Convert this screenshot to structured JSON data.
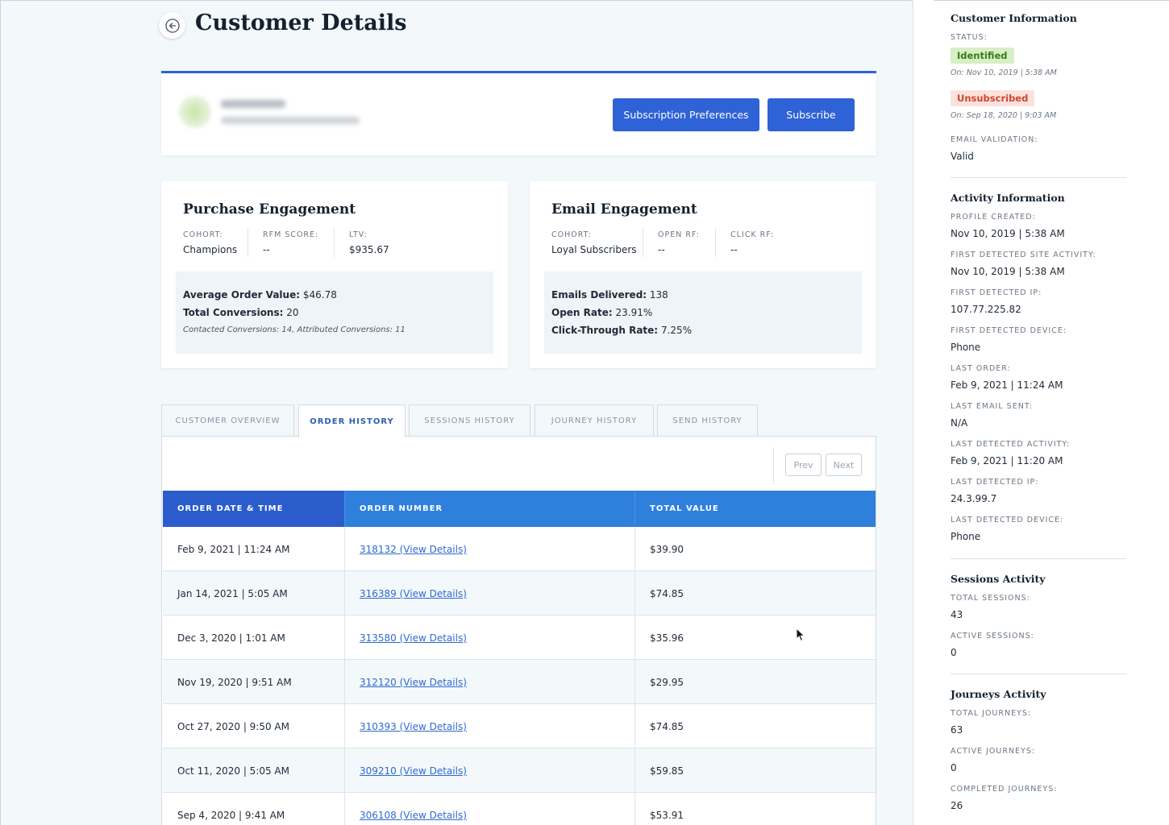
{
  "header": {
    "title": "Customer Details"
  },
  "customer_card": {
    "subscription_preferences_label": "Subscription Preferences",
    "subscribe_label": "Subscribe"
  },
  "purchase": {
    "title": "Purchase Engagement",
    "cohort_label": "COHORT:",
    "cohort": "Champions",
    "rfm_label": "RFM SCORE:",
    "rfm": "--",
    "ltv_label": "LTV:",
    "ltv": "$935.67",
    "aov_label": "Average Order Value:",
    "aov": "$46.78",
    "conv_label": "Total Conversions:",
    "conv": "20",
    "note": "Contacted Conversions: 14, Attributed Conversions: 11"
  },
  "email": {
    "title": "Email Engagement",
    "cohort_label": "COHORT:",
    "cohort": "Loyal Subscribers",
    "open_label": "OPEN RF:",
    "open": "--",
    "click_label": "CLICK RF:",
    "click": "--",
    "delivered_label": "Emails Delivered:",
    "delivered": "138",
    "open_rate_label": "Open Rate:",
    "open_rate": "23.91%",
    "ctr_label": "Click-Through Rate:",
    "ctr": "7.25%"
  },
  "tabs": [
    {
      "label": "CUSTOMER OVERVIEW"
    },
    {
      "label": "ORDER HISTORY"
    },
    {
      "label": "SESSIONS HISTORY"
    },
    {
      "label": "JOURNEY HISTORY"
    },
    {
      "label": "SEND HISTORY"
    }
  ],
  "pager": {
    "prev": "Prev",
    "next": "Next"
  },
  "orders": {
    "columns": [
      "ORDER DATE & TIME",
      "ORDER NUMBER",
      "TOTAL VALUE"
    ],
    "rows": [
      {
        "date": "Feb 9, 2021 | 11:24 AM",
        "number": "318132 (View Details)",
        "value": "$39.90"
      },
      {
        "date": "Jan 14, 2021 | 5:05 AM",
        "number": "316389 (View Details)",
        "value": "$74.85"
      },
      {
        "date": "Dec 3, 2020 | 1:01 AM",
        "number": "313580 (View Details)",
        "value": "$35.96"
      },
      {
        "date": "Nov 19, 2020 | 9:51 AM",
        "number": "312120 (View Details)",
        "value": "$29.95"
      },
      {
        "date": "Oct 27, 2020 | 9:50 AM",
        "number": "310393 (View Details)",
        "value": "$74.85"
      },
      {
        "date": "Oct 11, 2020 | 5:05 AM",
        "number": "309210 (View Details)",
        "value": "$59.85"
      },
      {
        "date": "Sep 4, 2020 | 9:41 AM",
        "number": "306108 (View Details)",
        "value": "$53.91"
      }
    ]
  },
  "sidebar": {
    "customer_info_title": "Customer Information",
    "status_label": "STATUS:",
    "identified": "Identified",
    "identified_on": "On: Nov 10, 2019 | 5:38 AM",
    "unsubscribed": "Unsubscribed",
    "unsubscribed_on": "On: Sep 18, 2020 | 9:03 AM",
    "email_validation_label": "EMAIL VALIDATION:",
    "email_validation": "Valid",
    "activity_title": "Activity Information",
    "profile_created_label": "PROFILE CREATED:",
    "profile_created": "Nov 10, 2019 | 5:38 AM",
    "first_site_label": "FIRST DETECTED SITE ACTIVITY:",
    "first_site": "Nov 10, 2019 | 5:38 AM",
    "first_ip_label": "FIRST DETECTED IP:",
    "first_ip": "107.77.225.82",
    "first_device_label": "FIRST DETECTED DEVICE:",
    "first_device": "Phone",
    "last_order_label": "LAST ORDER:",
    "last_order": "Feb 9, 2021 | 11:24 AM",
    "last_email_label": "LAST EMAIL SENT:",
    "last_email": "N/A",
    "last_activity_label": "LAST DETECTED ACTIVITY:",
    "last_activity": "Feb 9, 2021 | 11:20 AM",
    "last_ip_label": "LAST DETECTED IP:",
    "last_ip": "24.3.99.7",
    "last_device_label": "LAST DETECTED DEVICE:",
    "last_device": "Phone",
    "sessions_title": "Sessions Activity",
    "total_sessions_label": "TOTAL SESSIONS:",
    "total_sessions": "43",
    "active_sessions_label": "ACTIVE SESSIONS:",
    "active_sessions": "0",
    "journeys_title": "Journeys Activity",
    "total_journeys_label": "TOTAL JOURNEYS:",
    "total_journeys": "63",
    "active_journeys_label": "ACTIVE JOURNEYS:",
    "active_journeys": "0",
    "completed_journeys_label": "COMPLETED JOURNEYS:",
    "completed_journeys": "26"
  }
}
